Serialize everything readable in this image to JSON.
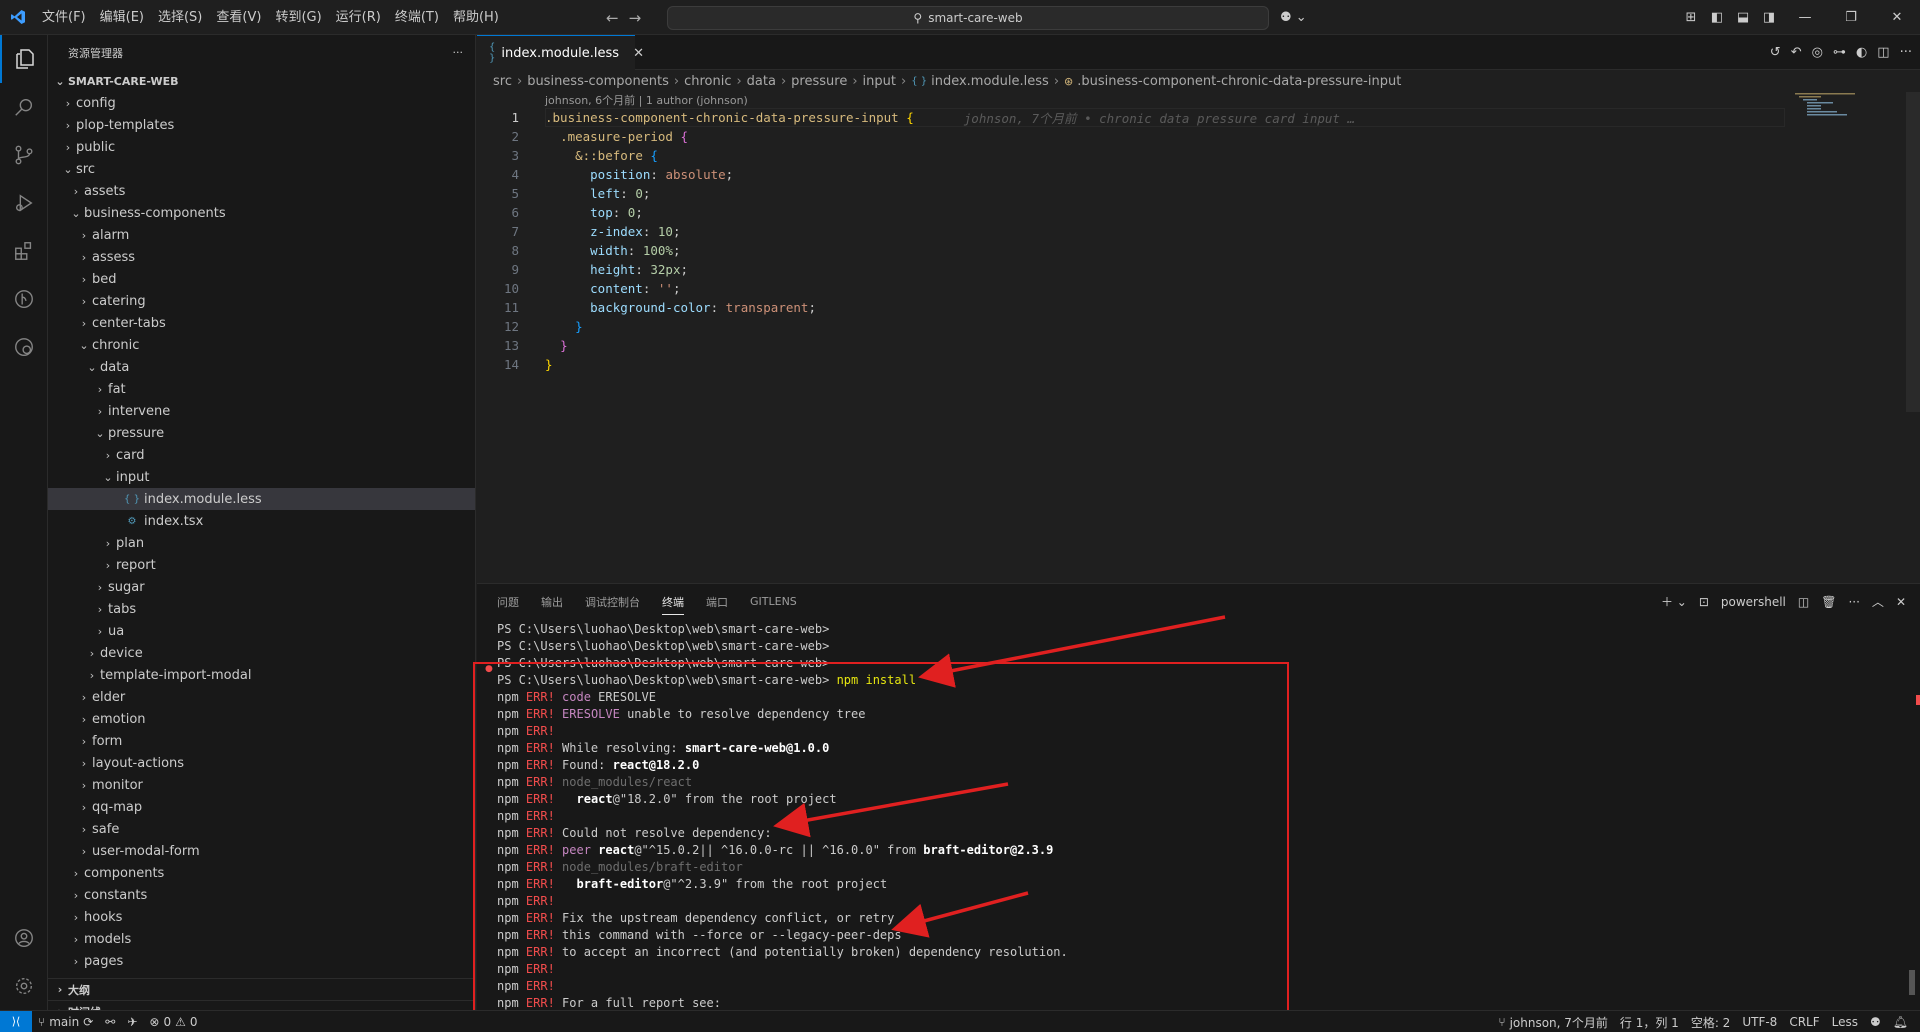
{
  "titlebar": {
    "menu": [
      "文件(F)",
      "编辑(E)",
      "选择(S)",
      "查看(V)",
      "转到(G)",
      "运行(R)",
      "终端(T)",
      "帮助(H)"
    ],
    "search": "smart-care-web"
  },
  "sidebar": {
    "title": "资源管理器",
    "more": "···",
    "root": "SMART-CARE-WEB",
    "tree": [
      {
        "label": "config",
        "depth": 1,
        "type": "folder",
        "open": false
      },
      {
        "label": "plop-templates",
        "depth": 1,
        "type": "folder",
        "open": false
      },
      {
        "label": "public",
        "depth": 1,
        "type": "folder",
        "open": false
      },
      {
        "label": "src",
        "depth": 1,
        "type": "folder",
        "open": true
      },
      {
        "label": "assets",
        "depth": 2,
        "type": "folder",
        "open": false
      },
      {
        "label": "business-components",
        "depth": 2,
        "type": "folder",
        "open": true
      },
      {
        "label": "alarm",
        "depth": 3,
        "type": "folder",
        "open": false
      },
      {
        "label": "assess",
        "depth": 3,
        "type": "folder",
        "open": false
      },
      {
        "label": "bed",
        "depth": 3,
        "type": "folder",
        "open": false
      },
      {
        "label": "catering",
        "depth": 3,
        "type": "folder",
        "open": false
      },
      {
        "label": "center-tabs",
        "depth": 3,
        "type": "folder",
        "open": false
      },
      {
        "label": "chronic",
        "depth": 3,
        "type": "folder",
        "open": true
      },
      {
        "label": "data",
        "depth": 4,
        "type": "folder",
        "open": true
      },
      {
        "label": "fat",
        "depth": 5,
        "type": "folder",
        "open": false
      },
      {
        "label": "intervene",
        "depth": 5,
        "type": "folder",
        "open": false
      },
      {
        "label": "pressure",
        "depth": 5,
        "type": "folder",
        "open": true
      },
      {
        "label": "card",
        "depth": 6,
        "type": "folder",
        "open": false
      },
      {
        "label": "input",
        "depth": 6,
        "type": "folder",
        "open": true
      },
      {
        "label": "index.module.less",
        "depth": 7,
        "type": "less",
        "selected": true
      },
      {
        "label": "index.tsx",
        "depth": 7,
        "type": "tsx"
      },
      {
        "label": "plan",
        "depth": 6,
        "type": "folder",
        "open": false
      },
      {
        "label": "report",
        "depth": 6,
        "type": "folder",
        "open": false
      },
      {
        "label": "sugar",
        "depth": 5,
        "type": "folder",
        "open": false
      },
      {
        "label": "tabs",
        "depth": 5,
        "type": "folder",
        "open": false
      },
      {
        "label": "ua",
        "depth": 5,
        "type": "folder",
        "open": false
      },
      {
        "label": "device",
        "depth": 4,
        "type": "folder",
        "open": false
      },
      {
        "label": "template-import-modal",
        "depth": 4,
        "type": "folder",
        "open": false
      },
      {
        "label": "elder",
        "depth": 3,
        "type": "folder",
        "open": false
      },
      {
        "label": "emotion",
        "depth": 3,
        "type": "folder",
        "open": false
      },
      {
        "label": "form",
        "depth": 3,
        "type": "folder",
        "open": false
      },
      {
        "label": "layout-actions",
        "depth": 3,
        "type": "folder",
        "open": false
      },
      {
        "label": "monitor",
        "depth": 3,
        "type": "folder",
        "open": false
      },
      {
        "label": "qq-map",
        "depth": 3,
        "type": "folder",
        "open": false
      },
      {
        "label": "safe",
        "depth": 3,
        "type": "folder",
        "open": false
      },
      {
        "label": "user-modal-form",
        "depth": 3,
        "type": "folder",
        "open": false
      },
      {
        "label": "components",
        "depth": 2,
        "type": "folder",
        "open": false
      },
      {
        "label": "constants",
        "depth": 2,
        "type": "folder",
        "open": false
      },
      {
        "label": "hooks",
        "depth": 2,
        "type": "folder",
        "open": false
      },
      {
        "label": "models",
        "depth": 2,
        "type": "folder",
        "open": false
      },
      {
        "label": "pages",
        "depth": 2,
        "type": "folder",
        "open": false
      }
    ],
    "outline": "大纲",
    "timeline": "时间线"
  },
  "editor": {
    "tab_label": "index.module.less",
    "breadcrumb": [
      "src",
      "business-components",
      "chronic",
      "data",
      "pressure",
      "input",
      "index.module.less",
      ".business-component-chronic-data-pressure-input"
    ],
    "codelens": "johnson, 6个月前 | 1 author (johnson)",
    "blame": "johnson, 7个月前 • chronic data pressure card input …",
    "line_numbers": [
      "1",
      "2",
      "3",
      "4",
      "5",
      "6",
      "7",
      "8",
      "9",
      "10",
      "11",
      "12",
      "13",
      "14"
    ]
  },
  "panel": {
    "tabs": [
      "问题",
      "输出",
      "调试控制台",
      "终端",
      "端口",
      "GITLENS"
    ],
    "active_tab": "终端",
    "shell": "powershell",
    "prompt": "PS C:\\Users\\luohao\\Desktop\\web\\smart-care-web>",
    "command": "npm install"
  },
  "statusbar": {
    "branch": "main",
    "errors": "0",
    "warnings": "0",
    "blame": "johnson, 7个月前",
    "position": "行 1，列 1",
    "spaces": "空格: 2",
    "encoding": "UTF-8",
    "eol": "CRLF",
    "language": "Less"
  },
  "colors": {
    "accent": "#0078d4",
    "error": "#f14c4c",
    "annotation": "#e02020"
  }
}
